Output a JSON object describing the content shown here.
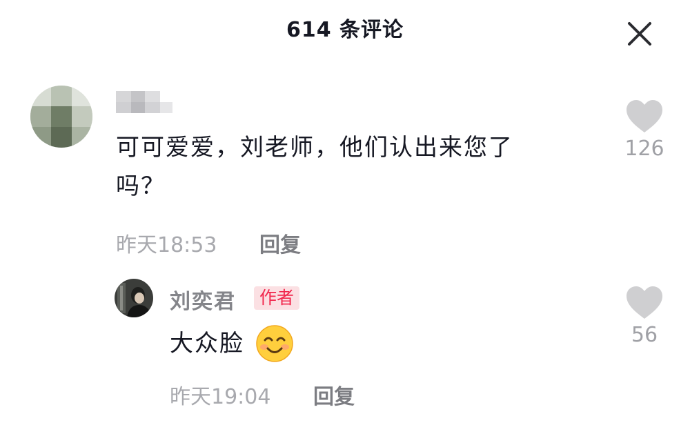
{
  "header": {
    "title": "614 条评论",
    "close_icon": "close-icon"
  },
  "comments": [
    {
      "username_blurred": true,
      "avatar": "blurred-avatar",
      "text_line1": "可可爱爱，刘老师，他们认出来您了",
      "text_line2": "吗？",
      "time": "昨天18:53",
      "reply_label": "回复",
      "likes": "126",
      "like_icon": "heart-icon"
    }
  ],
  "replies": [
    {
      "username": "刘奕君",
      "badge": "作者",
      "avatar": "author-avatar",
      "text": "大众脸",
      "emoji": "smiling-face",
      "time": "昨天19:04",
      "reply_label": "回复",
      "likes": "56",
      "like_icon": "heart-icon"
    }
  ],
  "colors": {
    "text_primary": "#161823",
    "text_secondary": "#a8a9ae",
    "reply_button": "#7c7d82",
    "like_icon": "#cfcfd1",
    "badge_bg": "#fbe0e3",
    "badge_text": "#f1274d"
  }
}
